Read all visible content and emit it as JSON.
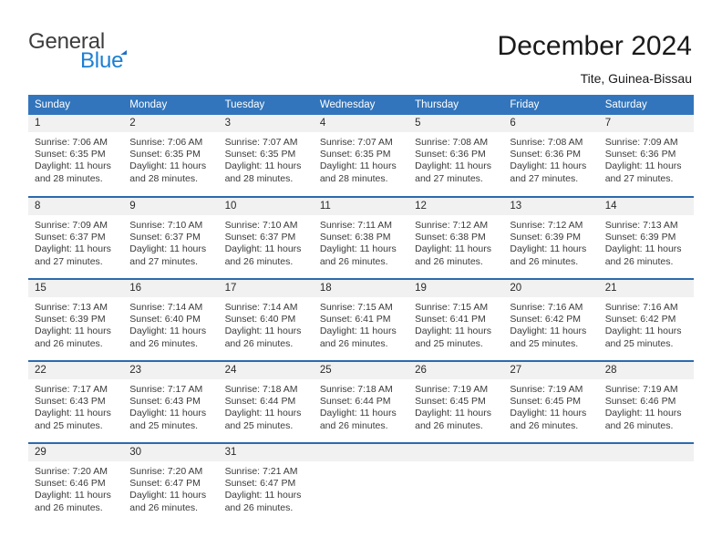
{
  "brand": {
    "name_top": "General",
    "name_bottom": "Blue",
    "triangle_icon": "triangle-icon",
    "color_top": "#3c3c3c",
    "color_bottom": "#1b7fd4",
    "triangle_color": "#1f6fc4"
  },
  "header": {
    "title": "December 2024",
    "subtitle": "Tite, Guinea-Bissau"
  },
  "calendar": {
    "header_bg": "#3275bc",
    "header_text_color": "#ffffff",
    "row_divider_color": "#2c6aad",
    "daynum_bg": "#f1f1f1",
    "weekdays": [
      "Sunday",
      "Monday",
      "Tuesday",
      "Wednesday",
      "Thursday",
      "Friday",
      "Saturday"
    ],
    "weeks": [
      [
        {
          "day": "1",
          "sunrise": "Sunrise: 7:06 AM",
          "sunset": "Sunset: 6:35 PM",
          "daylight_1": "Daylight: 11 hours",
          "daylight_2": "and 28 minutes."
        },
        {
          "day": "2",
          "sunrise": "Sunrise: 7:06 AM",
          "sunset": "Sunset: 6:35 PM",
          "daylight_1": "Daylight: 11 hours",
          "daylight_2": "and 28 minutes."
        },
        {
          "day": "3",
          "sunrise": "Sunrise: 7:07 AM",
          "sunset": "Sunset: 6:35 PM",
          "daylight_1": "Daylight: 11 hours",
          "daylight_2": "and 28 minutes."
        },
        {
          "day": "4",
          "sunrise": "Sunrise: 7:07 AM",
          "sunset": "Sunset: 6:35 PM",
          "daylight_1": "Daylight: 11 hours",
          "daylight_2": "and 28 minutes."
        },
        {
          "day": "5",
          "sunrise": "Sunrise: 7:08 AM",
          "sunset": "Sunset: 6:36 PM",
          "daylight_1": "Daylight: 11 hours",
          "daylight_2": "and 27 minutes."
        },
        {
          "day": "6",
          "sunrise": "Sunrise: 7:08 AM",
          "sunset": "Sunset: 6:36 PM",
          "daylight_1": "Daylight: 11 hours",
          "daylight_2": "and 27 minutes."
        },
        {
          "day": "7",
          "sunrise": "Sunrise: 7:09 AM",
          "sunset": "Sunset: 6:36 PM",
          "daylight_1": "Daylight: 11 hours",
          "daylight_2": "and 27 minutes."
        }
      ],
      [
        {
          "day": "8",
          "sunrise": "Sunrise: 7:09 AM",
          "sunset": "Sunset: 6:37 PM",
          "daylight_1": "Daylight: 11 hours",
          "daylight_2": "and 27 minutes."
        },
        {
          "day": "9",
          "sunrise": "Sunrise: 7:10 AM",
          "sunset": "Sunset: 6:37 PM",
          "daylight_1": "Daylight: 11 hours",
          "daylight_2": "and 27 minutes."
        },
        {
          "day": "10",
          "sunrise": "Sunrise: 7:10 AM",
          "sunset": "Sunset: 6:37 PM",
          "daylight_1": "Daylight: 11 hours",
          "daylight_2": "and 26 minutes."
        },
        {
          "day": "11",
          "sunrise": "Sunrise: 7:11 AM",
          "sunset": "Sunset: 6:38 PM",
          "daylight_1": "Daylight: 11 hours",
          "daylight_2": "and 26 minutes."
        },
        {
          "day": "12",
          "sunrise": "Sunrise: 7:12 AM",
          "sunset": "Sunset: 6:38 PM",
          "daylight_1": "Daylight: 11 hours",
          "daylight_2": "and 26 minutes."
        },
        {
          "day": "13",
          "sunrise": "Sunrise: 7:12 AM",
          "sunset": "Sunset: 6:39 PM",
          "daylight_1": "Daylight: 11 hours",
          "daylight_2": "and 26 minutes."
        },
        {
          "day": "14",
          "sunrise": "Sunrise: 7:13 AM",
          "sunset": "Sunset: 6:39 PM",
          "daylight_1": "Daylight: 11 hours",
          "daylight_2": "and 26 minutes."
        }
      ],
      [
        {
          "day": "15",
          "sunrise": "Sunrise: 7:13 AM",
          "sunset": "Sunset: 6:39 PM",
          "daylight_1": "Daylight: 11 hours",
          "daylight_2": "and 26 minutes."
        },
        {
          "day": "16",
          "sunrise": "Sunrise: 7:14 AM",
          "sunset": "Sunset: 6:40 PM",
          "daylight_1": "Daylight: 11 hours",
          "daylight_2": "and 26 minutes."
        },
        {
          "day": "17",
          "sunrise": "Sunrise: 7:14 AM",
          "sunset": "Sunset: 6:40 PM",
          "daylight_1": "Daylight: 11 hours",
          "daylight_2": "and 26 minutes."
        },
        {
          "day": "18",
          "sunrise": "Sunrise: 7:15 AM",
          "sunset": "Sunset: 6:41 PM",
          "daylight_1": "Daylight: 11 hours",
          "daylight_2": "and 26 minutes."
        },
        {
          "day": "19",
          "sunrise": "Sunrise: 7:15 AM",
          "sunset": "Sunset: 6:41 PM",
          "daylight_1": "Daylight: 11 hours",
          "daylight_2": "and 25 minutes."
        },
        {
          "day": "20",
          "sunrise": "Sunrise: 7:16 AM",
          "sunset": "Sunset: 6:42 PM",
          "daylight_1": "Daylight: 11 hours",
          "daylight_2": "and 25 minutes."
        },
        {
          "day": "21",
          "sunrise": "Sunrise: 7:16 AM",
          "sunset": "Sunset: 6:42 PM",
          "daylight_1": "Daylight: 11 hours",
          "daylight_2": "and 25 minutes."
        }
      ],
      [
        {
          "day": "22",
          "sunrise": "Sunrise: 7:17 AM",
          "sunset": "Sunset: 6:43 PM",
          "daylight_1": "Daylight: 11 hours",
          "daylight_2": "and 25 minutes."
        },
        {
          "day": "23",
          "sunrise": "Sunrise: 7:17 AM",
          "sunset": "Sunset: 6:43 PM",
          "daylight_1": "Daylight: 11 hours",
          "daylight_2": "and 25 minutes."
        },
        {
          "day": "24",
          "sunrise": "Sunrise: 7:18 AM",
          "sunset": "Sunset: 6:44 PM",
          "daylight_1": "Daylight: 11 hours",
          "daylight_2": "and 25 minutes."
        },
        {
          "day": "25",
          "sunrise": "Sunrise: 7:18 AM",
          "sunset": "Sunset: 6:44 PM",
          "daylight_1": "Daylight: 11 hours",
          "daylight_2": "and 26 minutes."
        },
        {
          "day": "26",
          "sunrise": "Sunrise: 7:19 AM",
          "sunset": "Sunset: 6:45 PM",
          "daylight_1": "Daylight: 11 hours",
          "daylight_2": "and 26 minutes."
        },
        {
          "day": "27",
          "sunrise": "Sunrise: 7:19 AM",
          "sunset": "Sunset: 6:45 PM",
          "daylight_1": "Daylight: 11 hours",
          "daylight_2": "and 26 minutes."
        },
        {
          "day": "28",
          "sunrise": "Sunrise: 7:19 AM",
          "sunset": "Sunset: 6:46 PM",
          "daylight_1": "Daylight: 11 hours",
          "daylight_2": "and 26 minutes."
        }
      ],
      [
        {
          "day": "29",
          "sunrise": "Sunrise: 7:20 AM",
          "sunset": "Sunset: 6:46 PM",
          "daylight_1": "Daylight: 11 hours",
          "daylight_2": "and 26 minutes."
        },
        {
          "day": "30",
          "sunrise": "Sunrise: 7:20 AM",
          "sunset": "Sunset: 6:47 PM",
          "daylight_1": "Daylight: 11 hours",
          "daylight_2": "and 26 minutes."
        },
        {
          "day": "31",
          "sunrise": "Sunrise: 7:21 AM",
          "sunset": "Sunset: 6:47 PM",
          "daylight_1": "Daylight: 11 hours",
          "daylight_2": "and 26 minutes."
        },
        {
          "day": "",
          "sunrise": "",
          "sunset": "",
          "daylight_1": "",
          "daylight_2": ""
        },
        {
          "day": "",
          "sunrise": "",
          "sunset": "",
          "daylight_1": "",
          "daylight_2": ""
        },
        {
          "day": "",
          "sunrise": "",
          "sunset": "",
          "daylight_1": "",
          "daylight_2": ""
        },
        {
          "day": "",
          "sunrise": "",
          "sunset": "",
          "daylight_1": "",
          "daylight_2": ""
        }
      ]
    ]
  }
}
